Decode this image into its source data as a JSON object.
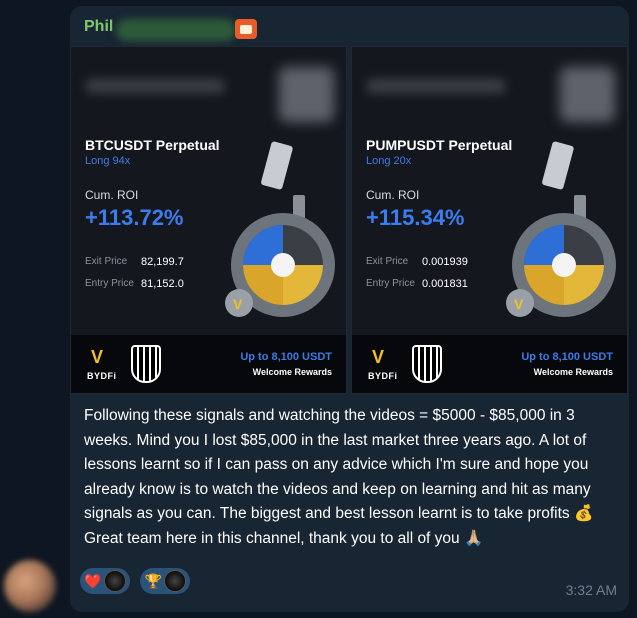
{
  "sender": {
    "name": "Phil"
  },
  "cards": [
    {
      "pair": "BTCUSDT Perpetual",
      "leverage": "Long 94x",
      "roi_label": "Cum. ROI",
      "roi": "+113.72%",
      "exit_label": "Exit Price",
      "exit_price": "82,199.7",
      "entry_label": "Entry Price",
      "entry_price": "81,152.0",
      "brand": "BYDFi",
      "promo": "Up to 8,100 USDT",
      "promo_sub": "Welcome Rewards"
    },
    {
      "pair": "PUMPUSDT Perpetual",
      "leverage": "Long 20x",
      "roi_label": "Cum. ROI",
      "roi": "+115.34%",
      "exit_label": "Exit Price",
      "exit_price": "0.001939",
      "entry_label": "Entry Price",
      "entry_price": "0.001831",
      "brand": "BYDFi",
      "promo": "Up to 8,100 USDT",
      "promo_sub": "Welcome Rewards"
    }
  ],
  "message": {
    "text": "Following these signals and watching the videos = $5000 - $85,000 in 3 weeks. Mind you I lost $85,000 in the last market three years ago. A lot of lessons learnt so if I can pass on any advice which I'm sure and hope you already know is to watch the videos and keep on learning and hit as many signals as you can. The biggest and best lesson learnt is to take profits 💰 Great team here in this channel, thank you to all of you 🙏🏼",
    "time": "3:32 AM"
  },
  "reactions": [
    {
      "emoji": "❤️",
      "icon": "heart-icon"
    },
    {
      "emoji": "🏆",
      "icon": "trophy-icon"
    }
  ],
  "colors": {
    "background": "#0e1621",
    "bubble": "#182533",
    "sender": "#7ec96d",
    "roi": "#3b7df0",
    "accent": "#3d7be6",
    "brand_yellow": "#f2c122"
  }
}
